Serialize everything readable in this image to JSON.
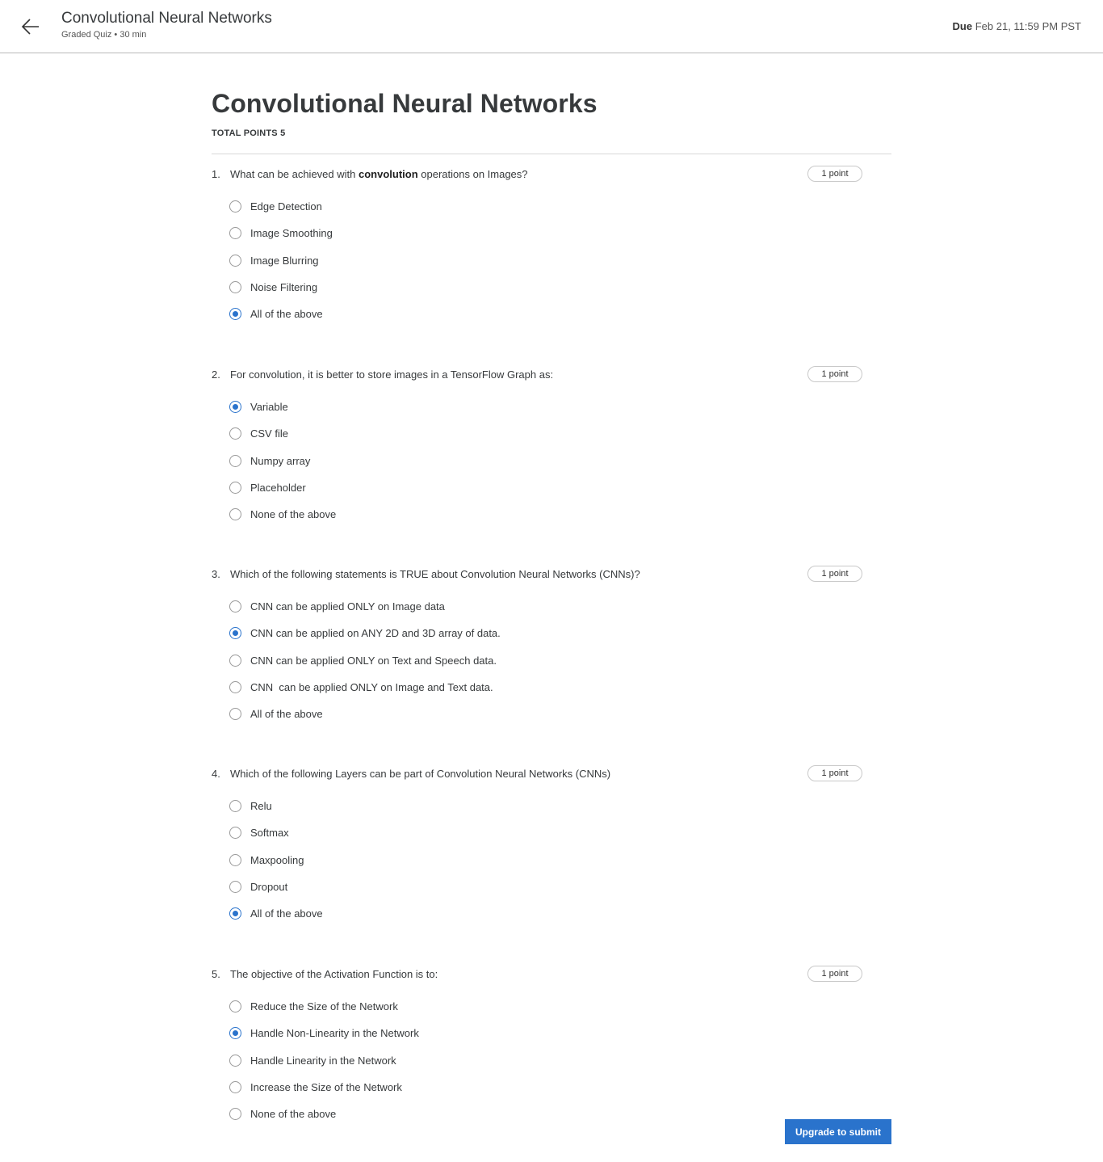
{
  "header": {
    "back_icon": "arrow-left-icon",
    "title": "Convolutional Neural Networks",
    "subtitle": "Graded Quiz • 30 min",
    "due_label": "Due",
    "due_value": "Feb 21, 11:59 PM PST"
  },
  "main": {
    "title": "Convolutional Neural Networks",
    "total_points": "TOTAL POINTS 5"
  },
  "questions": [
    {
      "number": "1.",
      "text_before": "What can be achieved with ",
      "text_bold": "convolution",
      "text_after": " operations on Images?",
      "points": "1 point",
      "options": [
        "Edge Detection",
        "Image Smoothing",
        "Image Blurring",
        "Noise Filtering",
        "All of the above"
      ],
      "selected": 4
    },
    {
      "number": "2.",
      "text": "For convolution, it is better to store images in a TensorFlow Graph as:",
      "points": "1 point",
      "options": [
        "Variable",
        "CSV file",
        "Numpy array",
        "Placeholder",
        "None of the above"
      ],
      "selected": 0
    },
    {
      "number": "3.",
      "text": "Which of the following statements is TRUE about Convolution Neural Networks (CNNs)?",
      "points": "1 point",
      "options": [
        "CNN can be applied ONLY on Image data",
        "CNN can be applied on ANY 2D and 3D array of data.",
        "CNN can be applied ONLY on Text and Speech data.",
        "CNN  can be applied ONLY on Image and Text data.",
        "All of the above"
      ],
      "selected": 1
    },
    {
      "number": "4.",
      "text": "Which of the following Layers can be part of Convolution Neural Networks (CNNs)",
      "points": "1 point",
      "options": [
        "Relu",
        "Softmax",
        "Maxpooling",
        "Dropout",
        "All of the above"
      ],
      "selected": 4
    },
    {
      "number": "5.",
      "text": "The objective of the Activation Function is to:",
      "points": "1 point",
      "options": [
        "Reduce the Size of the Network",
        "Handle Non-Linearity in the Network",
        "Handle Linearity in the Network",
        "Increase the Size of the Network",
        "None of the above"
      ],
      "selected": 1
    }
  ],
  "submit": {
    "label": "Upgrade to submit"
  },
  "colors": {
    "accent": "#2a73cc",
    "text": "#373a3c",
    "divider": "#d8d8d8"
  }
}
